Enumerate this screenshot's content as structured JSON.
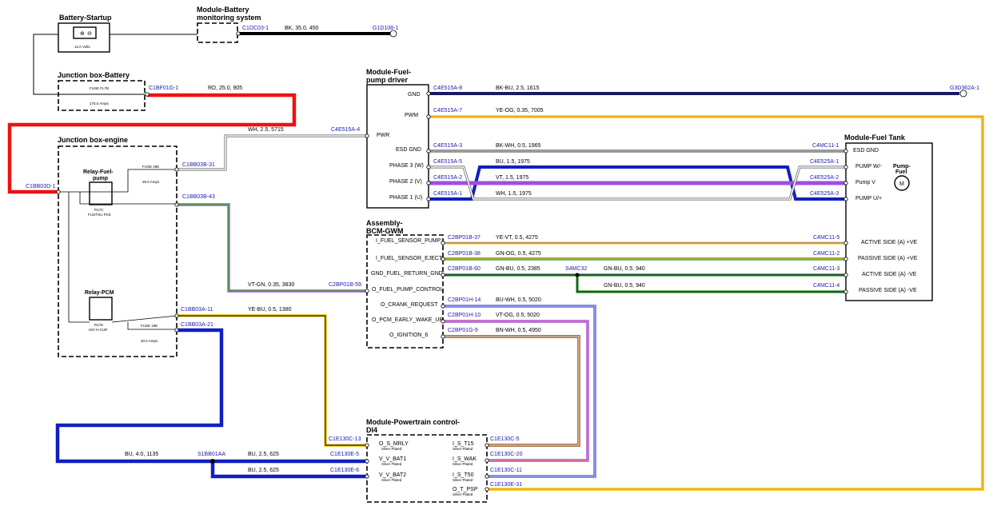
{
  "titles": {
    "battery_startup": "Battery-Startup",
    "module_battery_1": "Module-Battery",
    "module_battery_2": "monitoring system",
    "junction_battery": "Junction box-Battery",
    "junction_engine": "Junction box-engine",
    "fuel_pump_driver_1": "Module-Fuel-",
    "fuel_pump_driver_2": "pump driver",
    "fuel_tank": "Module-Fuel Tank",
    "bcm_1": "Assembly-",
    "bcm_2": "BCM-GWM",
    "pcm_1": "Module-Powertrain control-",
    "pcm_2": "DI4"
  },
  "components": {
    "battery_voltage": "12.0 Volts",
    "fuse_fl7b": "FUSE FL7B",
    "fuse_fl7b_amps": "175.0 Amps",
    "fuse_28e": "FUSE 28E",
    "fuse_28e_amps": "25.0 Amps",
    "fuse_19e": "FUSE 19E",
    "fuse_19e_amps": "40.0 Amps",
    "relay_fuel_1": "Relay-Fuel-",
    "relay_fuel_2": "pump",
    "relay_fuel_sub1": "R17C",
    "relay_fuel_sub2": "FUJITSU PC8",
    "relay_pcm": "Relay-PCM",
    "relay_pcm_sub1": "R17E",
    "relay_pcm_sub2": "ISO H-CUR",
    "pump_label_1": "Pump-",
    "pump_label_2": "Fuel"
  },
  "connectors": {
    "c1dc03": "C1DC03-1",
    "g1d108": "G1D108-1",
    "c1bf01g": "C1BF01G-1",
    "c1bb03d": "C1BB03D-1",
    "c1bb03b31": "C1BB03B-31",
    "c1bb03b43": "C1BB03B-43",
    "c1bb03a11": "C1BB03A-11",
    "c1bb03a21": "C1BB03A-21",
    "c4e515a4": "C4E515A-4",
    "c4e515a8": "C4E515A-8",
    "c4e515a7": "C4E515A-7",
    "c4e515a3": "C4E515A-3",
    "c4e515a5": "C4E515A-5",
    "c4e515a2": "C4E515A-2",
    "c4e515a1": "C4E515A-1",
    "g3d362a": "G3D362A-1",
    "c4mc11_1": "C4MC11-1",
    "c4e525a1": "C4E525A-1",
    "c4e525a2": "C4E525A-2",
    "c4e525a3": "C4E525A-3",
    "c2bp01b37": "C2BP01B-37",
    "c2bp01b38": "C2BP01B-38",
    "c2bp01b60": "C2BP01B-60",
    "c2bp01b59": "C2BP01B-59",
    "c2bp01h14": "C2BP01H-14",
    "c2bp01h10": "C2BP01H-10",
    "c2bp01g9": "C2BP01G-9",
    "s4mc32": "S4MC32",
    "c4mc11_5": "C4MC11-5",
    "c4mc11_2": "C4MC11-2",
    "c4mc11_3": "C4MC11-3",
    "c4mc11_4": "C4MC11-4",
    "c1e130c13": "C1E130C-13",
    "c1e130e5": "C1E130E-5",
    "c1e130e6": "C1E130E-6",
    "s1bb01aa": "S1BB01AA",
    "c1e130c5": "C1E130C-5",
    "c1e130c20": "C1E130C-20",
    "c1e130c11": "C1E130C-11",
    "c1e130e31": "C1E130E-31"
  },
  "wires": {
    "bk_35": "BK, 35.0, 450",
    "rd_25": "RD, 25.0, 905",
    "wh_5715": "WH, 2.5, 5715",
    "bkbu_1615": "BK-BU, 2.5, 1615",
    "yeog_7005": "YE-OG, 0.35, 7005",
    "bkwh_1965": "BK-WH, 0.5, 1965",
    "bu_1975": "BU, 1.5, 1975",
    "vt_1975": "VT, 1.5, 1975",
    "wh_1975": "WH, 1.5, 1975",
    "yevt_4275": "YE-VT, 0.5, 4275",
    "gnog_4275": "GN-OG, 0.5, 4275",
    "gnbu_2385": "GN-BU, 0.5, 2385",
    "gnbu_940a": "GN-BU, 0.5, 940",
    "gnbu_940b": "GN-BU, 0.5, 940",
    "vtgn_3830": "VT-GN, 0.35, 3830",
    "yebu_1380": "YE-BU, 0.5, 1380",
    "buwh_5020": "BU-WH, 0.5, 5020",
    "vtog_5020": "VT-OG, 0.5, 5020",
    "bnwh_4950": "BN-WH, 0.5, 4950",
    "bu_1135": "BU, 4.0, 1135",
    "bu_625a": "BU, 2.5, 625",
    "bu_625b": "BU, 2.5, 625"
  },
  "pins": {
    "gnd": "GND",
    "pwm": "PWM",
    "pwr": "PWR",
    "esd_gnd": "ESD GND",
    "phase3": "PHASE 3 (W)",
    "phase2": "PHASE 2 (V)",
    "phase1": "PHASE 1 (U)",
    "tank_esd": "ESD GND",
    "pump_w": "PUMP W/-",
    "pump_v": "Pump V",
    "pump_u": "PUMP U/+",
    "active_ve_pos": "ACTIVE SIDE (A) +VE",
    "passive_ve_pos": "PASSIVE SIDE (A) +VE",
    "active_ve_neg": "ACTIVE SIDE (A) -VE",
    "passive_ve_neg": "PASSIVE SIDE (A) -VE",
    "i_fuel_pump": "I_FUEL_SENSOR_PUMP",
    "i_fuel_eject": "I_FUEL_SENSOR_EJECT",
    "gnd_fuel_return": "GND_FUEL_RETURN_GND",
    "o_fuel_pump_control": "O_FUEL_PUMP_CONTROL",
    "o_crank": "O_CRANK_REQUEST",
    "o_pcm_wake": "O_PCM_EARLY_WAKE_UP",
    "o_ign": "O_IGNITION_6",
    "o_s_mrly": "O_S_MRLY",
    "v_v_bat1": "V_V_BAT1",
    "v_v_bat2": "V_V_BAT2",
    "i_s_t15": "I_S_T15",
    "i_s_wak": "I_S_WAK",
    "i_s_t50": "I_S_T50",
    "o_t_psp": "O_T_PSP",
    "silver": "Silver Plated"
  },
  "colors": {
    "bk": "#000000",
    "rd": "#ee1111",
    "bu": "#1020c0",
    "navy": "#1a1a60",
    "ye": "#f0c800",
    "og": "#f0a020",
    "vt": "#a050e0",
    "gn": "#48a830",
    "bn": "#8a4a10",
    "wh_edge": "#555555",
    "link": "#1a1aa8"
  }
}
